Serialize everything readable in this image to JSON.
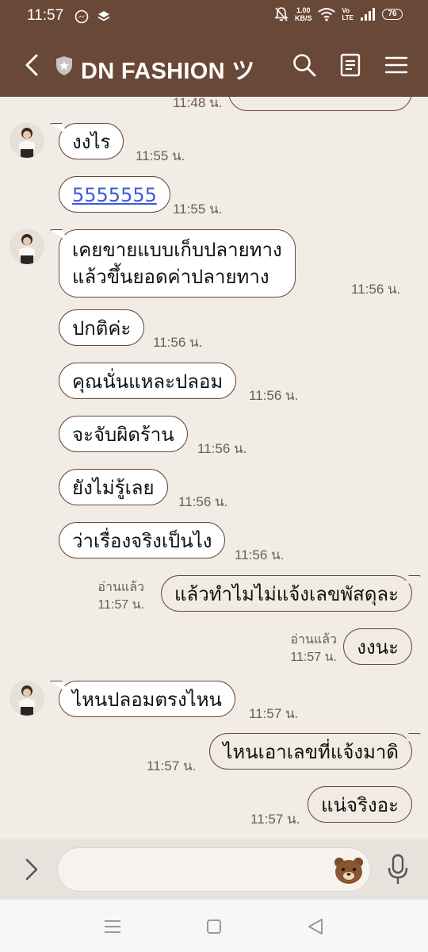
{
  "status_bar": {
    "time": "11:57",
    "net_speed_value": "1.00",
    "net_speed_unit": "KB/S",
    "volte_top": "Vo",
    "volte_bottom": "LTE",
    "battery": "76"
  },
  "header": {
    "title": "DN FASHION ツ"
  },
  "messages": {
    "m0_time": "11:48 น.",
    "m1_text": "งงไร",
    "m1_time": "11:55 น.",
    "m2_text": "5555555",
    "m2_time": "11:55 น.",
    "m3_line1": "เคยขายแบบเก็บปลายทาง",
    "m3_line2": "แล้วขึ้นยอดค่าปลายทาง",
    "m3_time": "11:56 น.",
    "m4_text": "ปกติค่ะ",
    "m4_time": "11:56 น.",
    "m5_text": "คุณนั่นแหละปลอม",
    "m5_time": "11:56 น.",
    "m6_text": "จะจับผิดร้าน",
    "m6_time": "11:56 น.",
    "m7_text": "ยังไม่รู้เลย",
    "m7_time": "11:56 น.",
    "m8_text": "ว่าเรื่องจริงเป็นไง",
    "m8_time": "11:56 น.",
    "m9_text": "แล้วทำไมไม่แจ้งเลขพัสดุละ",
    "m9_read": "อ่านแล้ว",
    "m9_time": "11:57 น.",
    "m10_text": "งงนะ",
    "m10_read": "อ่านแล้ว",
    "m10_time": "11:57 น.",
    "m11_text": "ไหนปลอมตรงไหน",
    "m11_time": "11:57 น.",
    "m12_text": "ไหนเอาเลขที่แจ้งมาดิ",
    "m12_time": "11:57 น.",
    "m13_text": "แน่จริงอะ",
    "m13_time": "11:57 น."
  },
  "input": {
    "placeholder": ""
  },
  "colors": {
    "header": "#6a4838",
    "chat_bg": "#f1ece5",
    "bubble_border": "#6a4838",
    "link": "#3b5bd6"
  },
  "icons": {
    "back": "back-arrow-icon",
    "shield": "shield-icon",
    "search": "search-icon",
    "notes": "notes-icon",
    "menu": "menu-icon",
    "expand": "chevron-right-icon",
    "sticker": "bear-sticker-icon",
    "mic": "microphone-icon"
  }
}
